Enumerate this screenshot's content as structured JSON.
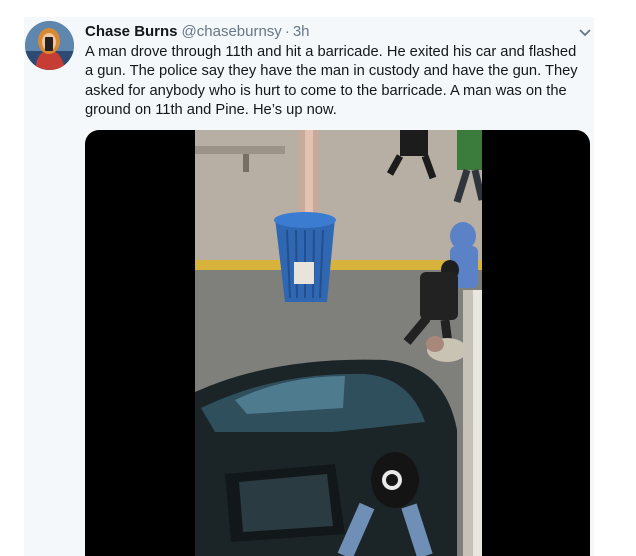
{
  "tweet": {
    "author_name": "Chase Burns",
    "handle": "@chaseburnsy",
    "separator": "·",
    "time": "3h",
    "text": "A man drove through 11th and hit a barricade. He exited his car and flashed a gun. The police say they have the man in custody and have the gun. They asked for anybody who is hurt to come to the barricade. A man was on the ground on 11th and Pine. He’s up now.",
    "avatar_icon": "profile-photo",
    "menu_icon": "chevron-down-icon"
  },
  "colors": {
    "card_background": "#f5f8fa",
    "text_primary": "#14171a",
    "text_secondary": "#657786",
    "media_background": "#000000"
  }
}
